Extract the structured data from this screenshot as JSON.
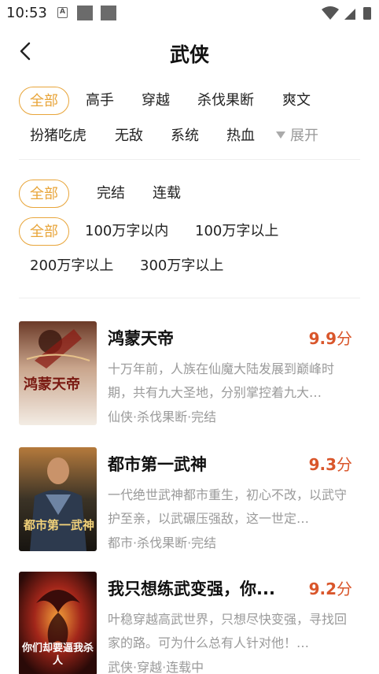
{
  "status_bar": {
    "time": "10:53",
    "icon_a": "A"
  },
  "header": {
    "title": "武侠"
  },
  "filters": {
    "categories": [
      "全部",
      "高手",
      "穿越",
      "杀伐果断",
      "爽文",
      "扮猪吃虎",
      "无敌",
      "系统",
      "热血"
    ],
    "expand_label": "展开",
    "status": [
      "全部",
      "完结",
      "连载"
    ],
    "length": [
      "全部",
      "100万字以内",
      "100万字以上",
      "200万字以上",
      "300万字以上"
    ]
  },
  "books": [
    {
      "title": "鸿蒙天帝",
      "score": "9.9",
      "score_unit": "分",
      "desc": "十万年前，人族在仙魔大陆发展到巅峰时期，共有九大圣地，分别掌控着九大…",
      "meta": "仙侠·杀伐果断·完结",
      "cover_text": "鸿蒙天帝"
    },
    {
      "title": "都市第一武神",
      "score": "9.3",
      "score_unit": "分",
      "desc": "一代绝世武神都市重生，初心不改，以武守护至亲，以武碾压强敌，这一世定…",
      "meta": "都市·杀伐果断·完结",
      "cover_text": "都市第一武神"
    },
    {
      "title": "我只想练武变强，你...",
      "score": "9.2",
      "score_unit": "分",
      "desc": "叶稳穿越高武世界，只想尽快变强，寻找回家的路。可为什么总有人针对他！…",
      "meta": "武侠·穿越·连载中",
      "cover_text": "你们却要逼我杀人"
    }
  ],
  "colors": {
    "accent": "#e8a53a",
    "score": "#d9562b"
  }
}
